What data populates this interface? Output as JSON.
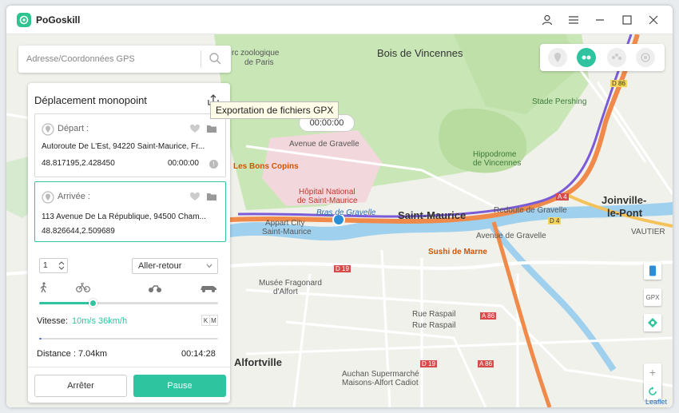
{
  "app": {
    "title": "PoGoskill"
  },
  "search": {
    "placeholder": "Adresse/Coordonnées GPS"
  },
  "panel": {
    "title": "Déplacement monopoint",
    "export_tooltip": "Exportation de fichiers GPX",
    "start": {
      "label": "Départ :",
      "address": "Autoroute De L'Est, 94220 Saint-Maurice, Fr...",
      "coords": "48.817195,2.428450",
      "time": "00:00:00"
    },
    "end": {
      "label": "Arrivée :",
      "address": "113 Avenue De La République, 94500 Cham...",
      "coords": "48.826644,2.509689"
    },
    "loop_count": "1",
    "mode_select": "Aller-retour",
    "speed_label": "Vitesse:",
    "speed_value": "10m/s 36km/h",
    "speed_fraction": 0.3,
    "progress_fraction": 0.01,
    "unit_k": "K",
    "unit_m": "M",
    "distance": "Distance : 7.04km",
    "elapsed": "00:14:28",
    "stop_label": "Arrêter",
    "pause_label": "Pause"
  },
  "map": {
    "timer": "00:00:00",
    "gpx_label": "GPX",
    "attribution": "Leaflet",
    "zoom_in": "+",
    "zoom_out": "−",
    "labels": {
      "bois": "Bois de Vincennes",
      "saint_maurice": "Saint-Maurice",
      "joinville1": "Joinville-",
      "joinville2": "le-Pont",
      "alfortville": "Alfortville",
      "vautier": "VAUTIER",
      "hopital1": "Hôpital National",
      "hopital2": "de Saint-Maurice",
      "hippodrome1": "Hippodrome",
      "hippodrome2": "de Vincennes",
      "stade": "Stade Pershing",
      "gravelle": "Avenue de Gravelle",
      "gravelle2": "Avenue de Gravelle",
      "copins": "Les Bons Copins",
      "sushi": "Sushi de Marne",
      "appart1": "Appart City",
      "appart2": "Saint-Maurice",
      "musee1": "Musée Fragonard",
      "musee2": "d'Alfort",
      "auchan1": "Auchan Supermarché",
      "auchan2": "Maisons-Alfort Cadiot",
      "redoute": "Redoute de Gravelle",
      "bras": "Bras de Gravelle",
      "raspail1": "Rue Raspail",
      "raspail2": "Rue Raspail",
      "zoo1": "rc zoologique",
      "zoo2": "de Paris",
      "d19a": "D 19",
      "d19b": "D 19",
      "a4": "A 4",
      "a86a": "A 86",
      "a86b": "A 86",
      "d4": "D 4",
      "d86": "D 86"
    }
  },
  "colors": {
    "accent": "#2ec4a0",
    "route": "#7b5bd6",
    "highway": "#f08a4b",
    "water": "#9fd0ee",
    "park": "#c9e7b6"
  }
}
